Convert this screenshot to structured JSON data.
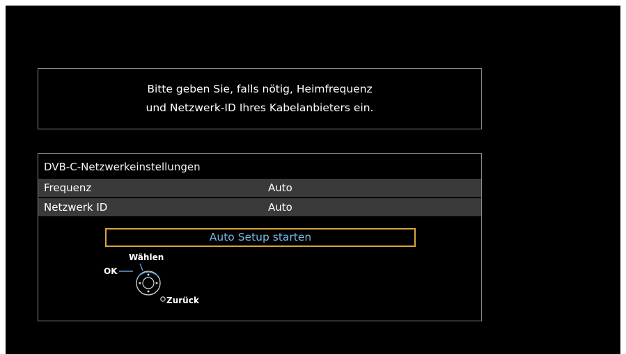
{
  "message": {
    "line1": "Bitte geben Sie, falls nötig, Heimfrequenz",
    "line2": "und Netzwerk-ID Ihres Kabelanbieters ein."
  },
  "panel": {
    "title": "DVB-C-Netzwerkeinstellungen",
    "rows": [
      {
        "label": "Frequenz",
        "value": "Auto"
      },
      {
        "label": "Netzwerk ID",
        "value": "Auto"
      }
    ],
    "action_button": "Auto Setup starten"
  },
  "remote_hint": {
    "select_label": "Wählen",
    "ok_label": "OK",
    "back_label": "Zurück",
    "icon": "remote-dpad-icon"
  },
  "colors": {
    "background": "#000000",
    "border": "#8a8a8a",
    "row_background": "#3a3a3a",
    "button_border": "#d9a53a",
    "button_text": "#7ab8e8",
    "hint_line": "#5aa0d8"
  }
}
